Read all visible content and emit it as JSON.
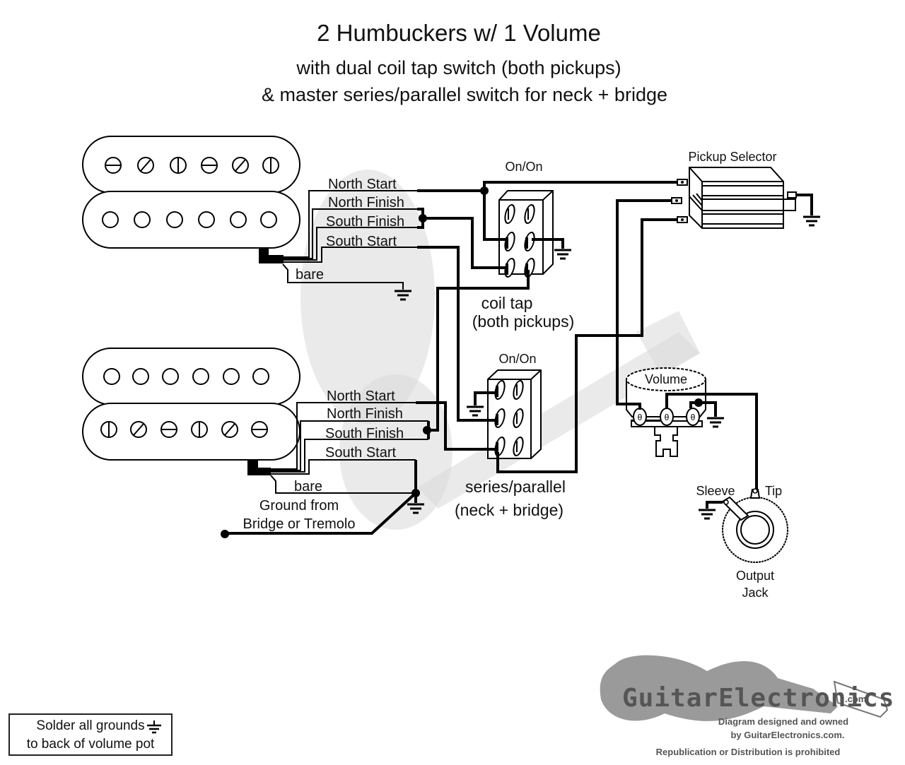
{
  "header": {
    "title": "2 Humbuckers w/ 1 Volume",
    "subtitle_line1": "with dual coil tap switch (both pickups)",
    "subtitle_line2": "& master series/parallel switch for neck + bridge"
  },
  "neck_pickup": {
    "leads": [
      "North Start",
      "North Finish",
      "South Finish",
      "South Start"
    ],
    "bare_label": "bare"
  },
  "bridge_pickup": {
    "leads": [
      "North Start",
      "North Finish",
      "South Finish",
      "South Start"
    ],
    "bare_label": "bare",
    "ground_label_line1": "Ground from",
    "ground_label_line2": "Bridge or Tremolo"
  },
  "coil_tap_switch": {
    "type_label": "On/On",
    "caption_line1": "coil tap",
    "caption_line2": "(both pickups)"
  },
  "series_parallel_switch": {
    "type_label": "On/On",
    "caption_line1": "series/parallel",
    "caption_line2": "(neck + bridge)"
  },
  "pickup_selector": {
    "label": "Pickup Selector"
  },
  "volume_pot": {
    "label": "Volume"
  },
  "output_jack": {
    "sleeve_label": "Sleeve",
    "tip_label": "Tip",
    "caption_line1": "Output",
    "caption_line2": "Jack"
  },
  "note": {
    "line1": "Solder all grounds",
    "line2": "to back of volume pot"
  },
  "branding": {
    "logo": "GuitarElectronics",
    "logo_suffix": ".com",
    "credit_line1": "Diagram designed and owned",
    "credit_line2": "by GuitarElectronics.com.",
    "notice": "Republication or Distribution is prohibited"
  }
}
